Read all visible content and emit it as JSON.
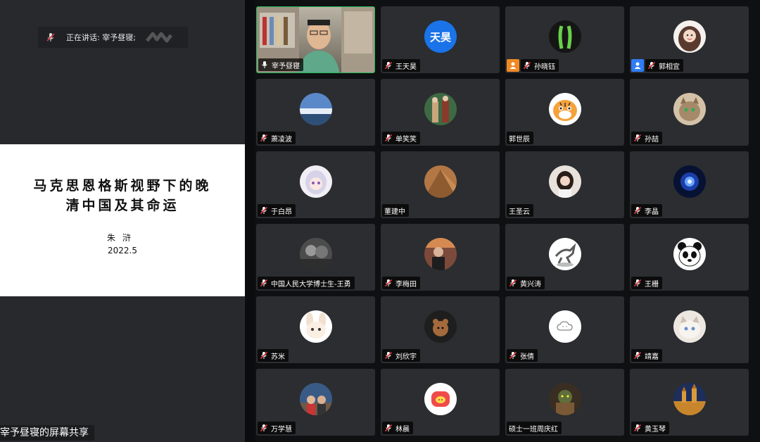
{
  "speaking": {
    "label": "正在讲话: 宰予昼寝;"
  },
  "slide": {
    "title_line1": "马克思恩格斯视野下的晚",
    "title_line2": "清中国及其命运",
    "author": "朱浒",
    "date": "2022.5"
  },
  "share_label": "宰予昼寝的屏幕共享",
  "colors": {
    "tile": "#2b2d30",
    "active_border": "#21b559",
    "badge_orange": "#f08a24",
    "badge_blue": "#2f7cf6"
  },
  "participants": [
    {
      "name": "宰予昼寝",
      "avatar": "video",
      "mic": "on",
      "active": true
    },
    {
      "name": "王天昊",
      "avatar": "天昊",
      "mic": "muted"
    },
    {
      "name": "孙晓钰",
      "avatar": "plant",
      "mic": "muted",
      "badge": "orange"
    },
    {
      "name": "郭相宜",
      "avatar": "girl",
      "mic": "muted",
      "badge": "blue"
    },
    {
      "name": "萧凌波",
      "avatar": "sky",
      "mic": "muted"
    },
    {
      "name": "单笑笑",
      "avatar": "costume",
      "mic": "muted"
    },
    {
      "name": "郭世辰",
      "avatar": "tiger",
      "mic": "none"
    },
    {
      "name": "孙喆",
      "avatar": "cat",
      "mic": "muted"
    },
    {
      "name": "于白昂",
      "avatar": "anime",
      "mic": "muted"
    },
    {
      "name": "董建中",
      "avatar": "brown",
      "mic": "none"
    },
    {
      "name": "王圣云",
      "avatar": "selfie",
      "mic": "none"
    },
    {
      "name": "李晶",
      "avatar": "galaxy",
      "mic": "muted"
    },
    {
      "name": "中国人民大学博士生-王勇",
      "avatar": "bw",
      "mic": "muted"
    },
    {
      "name": "李梅田",
      "avatar": "man",
      "mic": "muted"
    },
    {
      "name": "黄兴涛",
      "avatar": "horse",
      "mic": "muted"
    },
    {
      "name": "王栅",
      "avatar": "panda",
      "mic": "muted"
    },
    {
      "name": "苏米",
      "avatar": "bunny",
      "mic": "muted"
    },
    {
      "name": "刘欣宇",
      "avatar": "bear",
      "mic": "muted"
    },
    {
      "name": "张倩",
      "avatar": "cloud",
      "mic": "muted"
    },
    {
      "name": "靖嘉",
      "avatar": "kitten",
      "mic": "muted"
    },
    {
      "name": "万学慧",
      "avatar": "street",
      "mic": "muted"
    },
    {
      "name": "林晨",
      "avatar": "pig",
      "mic": "muted"
    },
    {
      "name": "硕士一班周庆红",
      "avatar": "warrior",
      "mic": "none"
    },
    {
      "name": "黄玉琴",
      "avatar": "castle",
      "mic": "muted"
    }
  ]
}
